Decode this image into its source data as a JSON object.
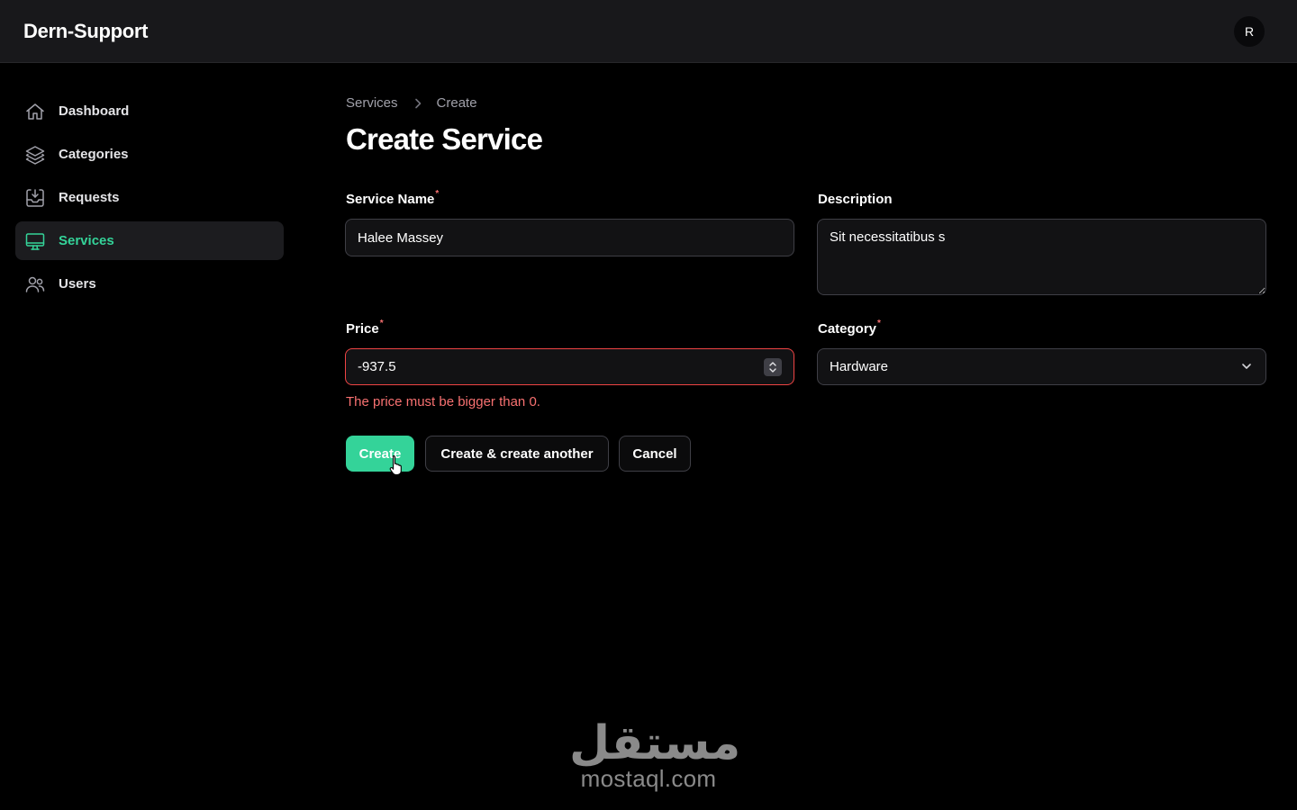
{
  "app": {
    "brand": "Dern-Support",
    "avatar_initial": "R"
  },
  "sidebar": {
    "items": [
      {
        "label": "Dashboard",
        "icon": "home-icon",
        "active": false
      },
      {
        "label": "Categories",
        "icon": "layers-icon",
        "active": false
      },
      {
        "label": "Requests",
        "icon": "inbox-icon",
        "active": false
      },
      {
        "label": "Services",
        "icon": "monitor-icon",
        "active": true
      },
      {
        "label": "Users",
        "icon": "users-icon",
        "active": false
      }
    ]
  },
  "breadcrumb": {
    "items": [
      "Services",
      "Create"
    ]
  },
  "page": {
    "title": "Create Service"
  },
  "form": {
    "service_name": {
      "label": "Service Name",
      "required_mark": "*",
      "value": "Halee Massey"
    },
    "description": {
      "label": "Description",
      "value": "Sit necessitatibus s"
    },
    "price": {
      "label": "Price",
      "required_mark": "*",
      "value": "-937.5",
      "error": "The price must be bigger than 0."
    },
    "category": {
      "label": "Category",
      "required_mark": "*",
      "value": "Hardware"
    }
  },
  "actions": {
    "create": "Create",
    "create_another": "Create & create another",
    "cancel": "Cancel"
  },
  "watermark": {
    "arabic": "مستقل",
    "latin": "mostaql.com"
  },
  "colors": {
    "accent": "#34d399",
    "error": "#f87171",
    "background": "#000000",
    "topbar": "#18181b"
  }
}
